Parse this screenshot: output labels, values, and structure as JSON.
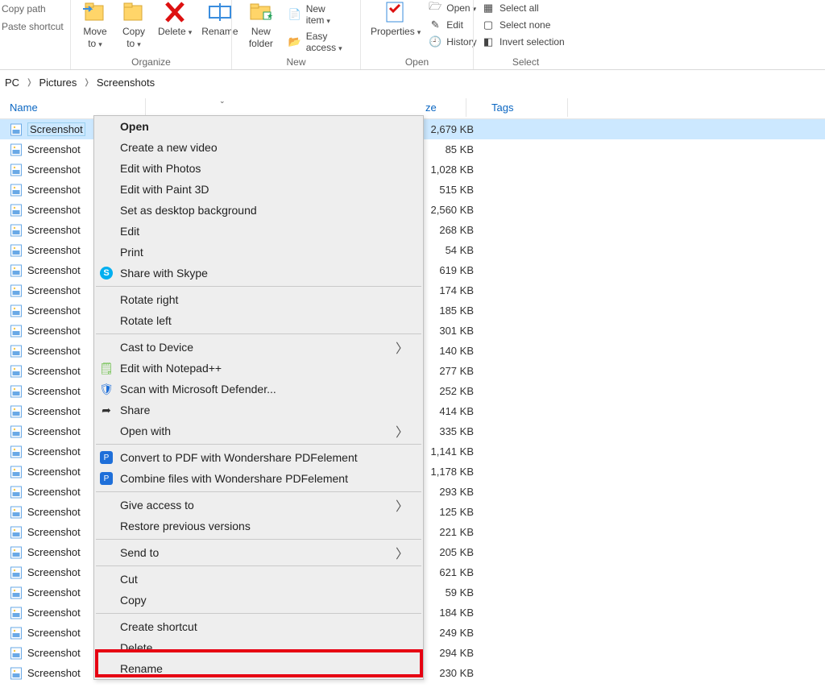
{
  "ribbon": {
    "left": {
      "copy_path": "Copy path",
      "paste_shortcut": "Paste shortcut"
    },
    "organize": {
      "move_to": "Move to",
      "copy_to": "Copy to",
      "delete": "Delete",
      "rename": "Rename",
      "caption": "Organize"
    },
    "new": {
      "new_folder": "New folder",
      "new_item": "New item",
      "easy_access": "Easy access",
      "caption": "New"
    },
    "open": {
      "properties": "Properties",
      "open": "Open",
      "edit": "Edit",
      "history": "History",
      "caption": "Open"
    },
    "select": {
      "select_all": "Select all",
      "select_none": "Select none",
      "invert": "Invert selection",
      "caption": "Select"
    }
  },
  "breadcrumb": [
    "PC",
    "Pictures",
    "Screenshots"
  ],
  "columns": {
    "name": "Name",
    "size": "ze",
    "tags": "Tags"
  },
  "files": [
    {
      "name": "Screenshot",
      "size": "2,679 KB",
      "selected": true
    },
    {
      "name": "Screenshot",
      "size": "85 KB"
    },
    {
      "name": "Screenshot",
      "size": "1,028 KB"
    },
    {
      "name": "Screenshot",
      "size": "515 KB"
    },
    {
      "name": "Screenshot",
      "size": "2,560 KB"
    },
    {
      "name": "Screenshot",
      "size": "268 KB"
    },
    {
      "name": "Screenshot",
      "size": "54 KB"
    },
    {
      "name": "Screenshot",
      "size": "619 KB"
    },
    {
      "name": "Screenshot",
      "size": "174 KB"
    },
    {
      "name": "Screenshot",
      "size": "185 KB"
    },
    {
      "name": "Screenshot",
      "size": "301 KB"
    },
    {
      "name": "Screenshot",
      "size": "140 KB"
    },
    {
      "name": "Screenshot",
      "size": "277 KB"
    },
    {
      "name": "Screenshot",
      "size": "252 KB"
    },
    {
      "name": "Screenshot",
      "size": "414 KB"
    },
    {
      "name": "Screenshot",
      "size": "335 KB"
    },
    {
      "name": "Screenshot",
      "size": "1,141 KB"
    },
    {
      "name": "Screenshot",
      "size": "1,178 KB"
    },
    {
      "name": "Screenshot",
      "size": "293 KB"
    },
    {
      "name": "Screenshot",
      "size": "125 KB"
    },
    {
      "name": "Screenshot",
      "size": "221 KB"
    },
    {
      "name": "Screenshot",
      "size": "205 KB"
    },
    {
      "name": "Screenshot",
      "size": "621 KB"
    },
    {
      "name": "Screenshot",
      "size": "59 KB"
    },
    {
      "name": "Screenshot",
      "size": "184 KB"
    },
    {
      "name": "Screenshot",
      "size": "249 KB"
    },
    {
      "name": "Screenshot",
      "size": "294 KB"
    },
    {
      "name": "Screenshot",
      "size": "230 KB"
    }
  ],
  "context_menu": [
    {
      "label": "Open",
      "bold": true
    },
    {
      "label": "Create a new video"
    },
    {
      "label": "Edit with Photos"
    },
    {
      "label": "Edit with Paint 3D"
    },
    {
      "label": "Set as desktop background"
    },
    {
      "label": "Edit"
    },
    {
      "label": "Print"
    },
    {
      "label": "Share with Skype",
      "icon": "skype"
    },
    {
      "sep": true
    },
    {
      "label": "Rotate right"
    },
    {
      "label": "Rotate left"
    },
    {
      "sep": true
    },
    {
      "label": "Cast to Device",
      "submenu": true
    },
    {
      "label": "Edit with Notepad++",
      "icon": "notepad"
    },
    {
      "label": "Scan with Microsoft Defender...",
      "icon": "defender"
    },
    {
      "label": "Share",
      "icon": "share"
    },
    {
      "label": "Open with",
      "submenu": true
    },
    {
      "sep": true
    },
    {
      "label": "Convert to PDF with Wondershare PDFelement",
      "icon": "pdf1"
    },
    {
      "label": "Combine files with Wondershare PDFelement",
      "icon": "pdf2"
    },
    {
      "sep": true
    },
    {
      "label": "Give access to",
      "submenu": true
    },
    {
      "label": "Restore previous versions"
    },
    {
      "sep": true
    },
    {
      "label": "Send to",
      "submenu": true
    },
    {
      "sep": true
    },
    {
      "label": "Cut"
    },
    {
      "label": "Copy"
    },
    {
      "sep": true
    },
    {
      "label": "Create shortcut"
    },
    {
      "label": "Delete",
      "hl": true
    },
    {
      "label": "Rename"
    }
  ]
}
